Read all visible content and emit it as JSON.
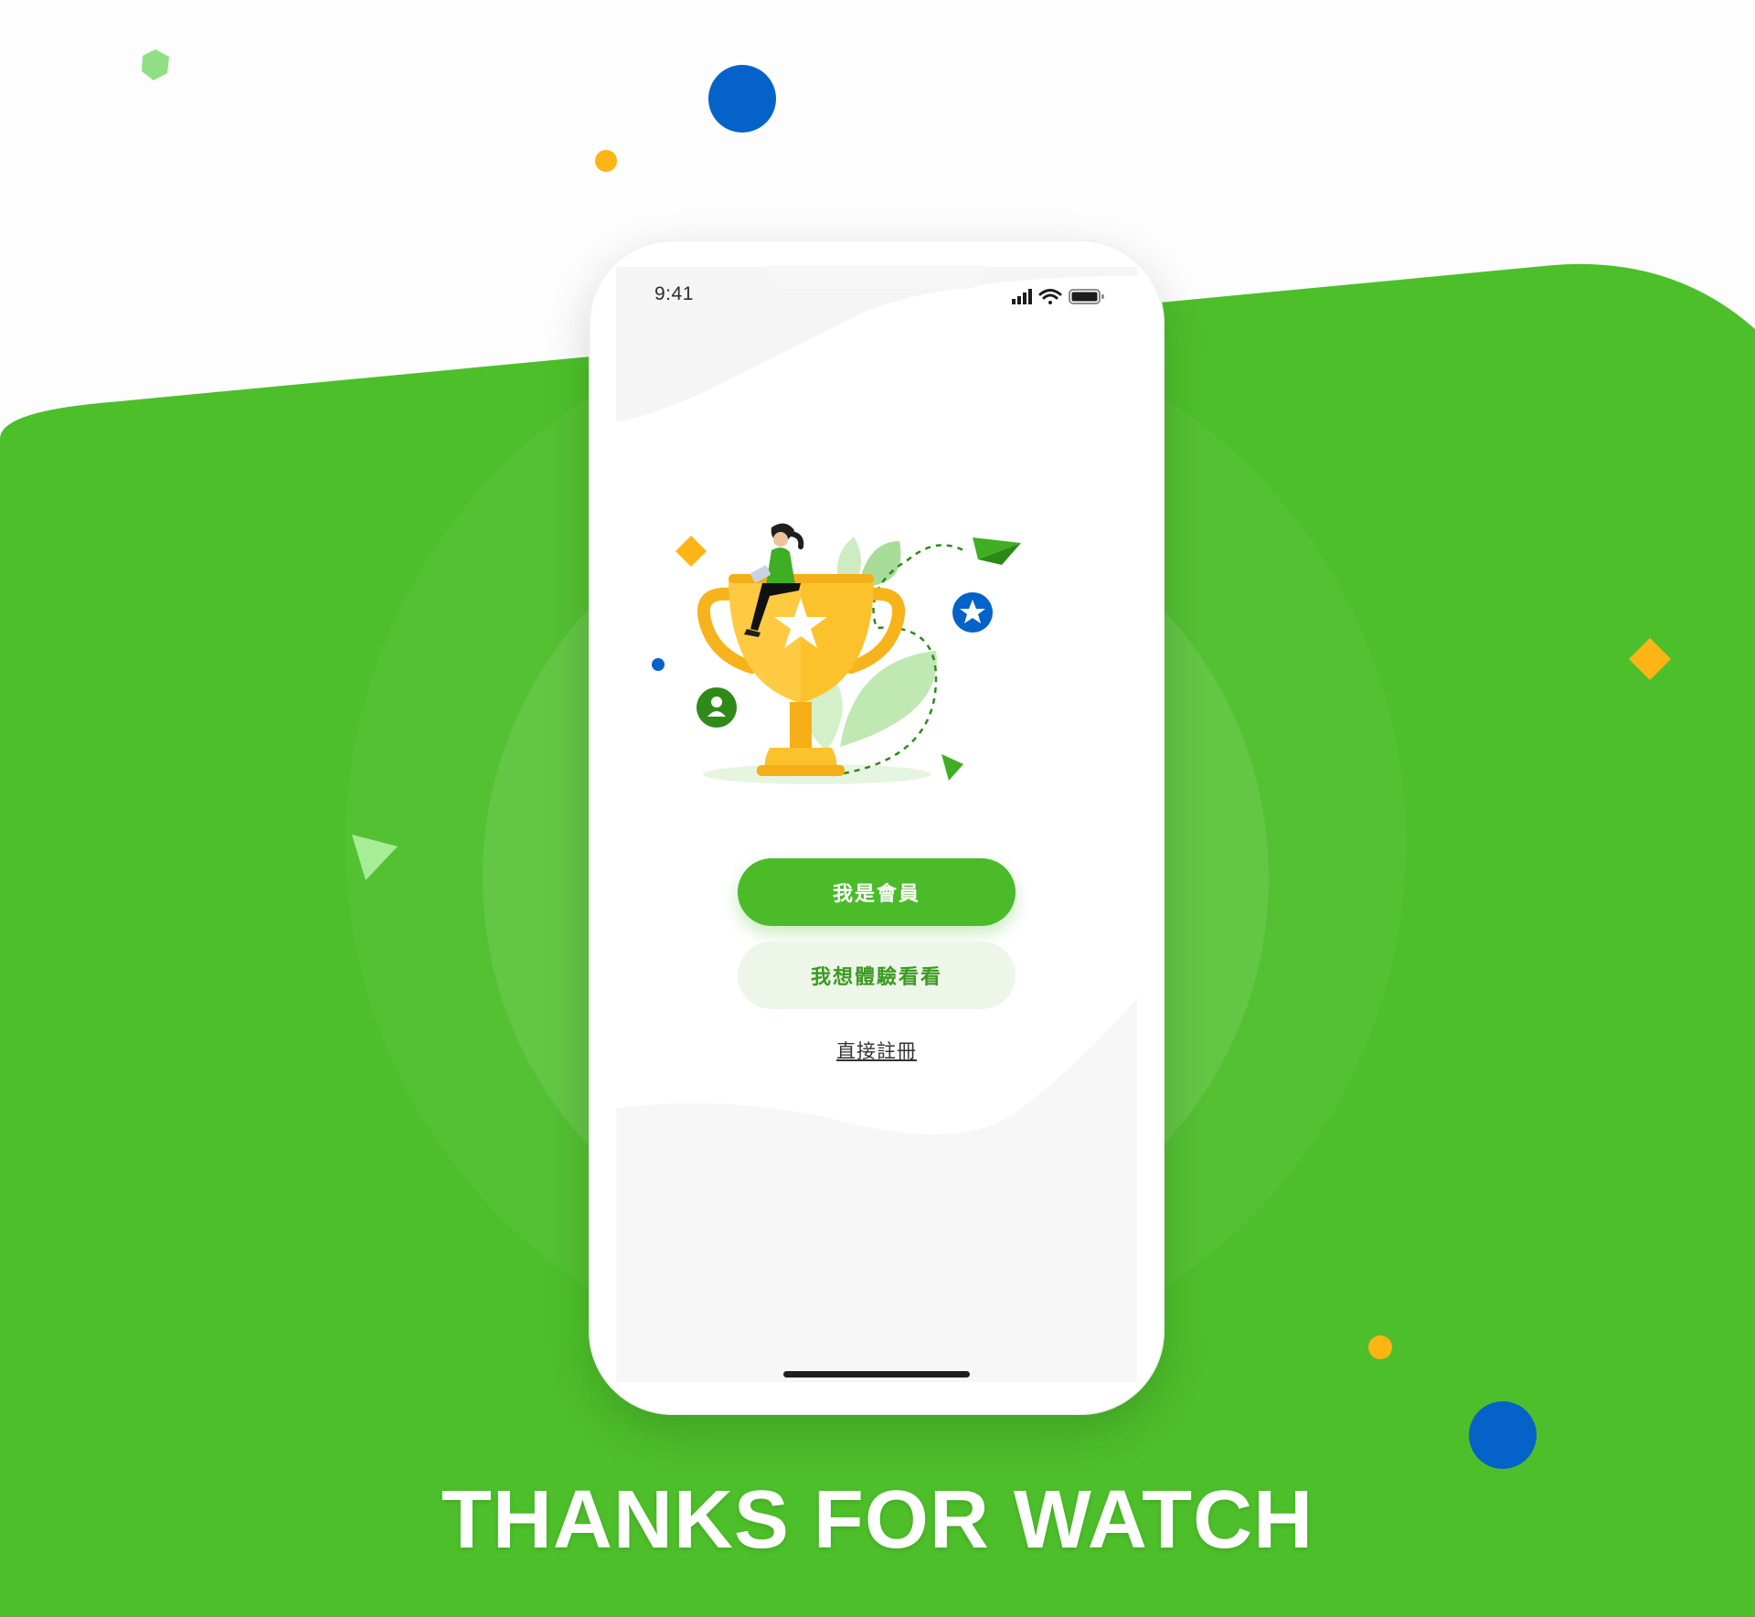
{
  "status_bar": {
    "time": "9:41",
    "icons": [
      "signal-icon",
      "wifi-icon",
      "battery-icon"
    ]
  },
  "welcome": {
    "illustration": "trophy-illustration",
    "member_button": "我是會員",
    "trial_button": "我想體驗看看",
    "register_link": "直接註冊"
  },
  "footer": {
    "title": "THANKS FOR WATCH"
  },
  "colors": {
    "brand_green": "#4cbb2a",
    "light_green": "#edf6e8",
    "accent_blue": "#0562c8",
    "accent_yellow": "#fdb515"
  }
}
